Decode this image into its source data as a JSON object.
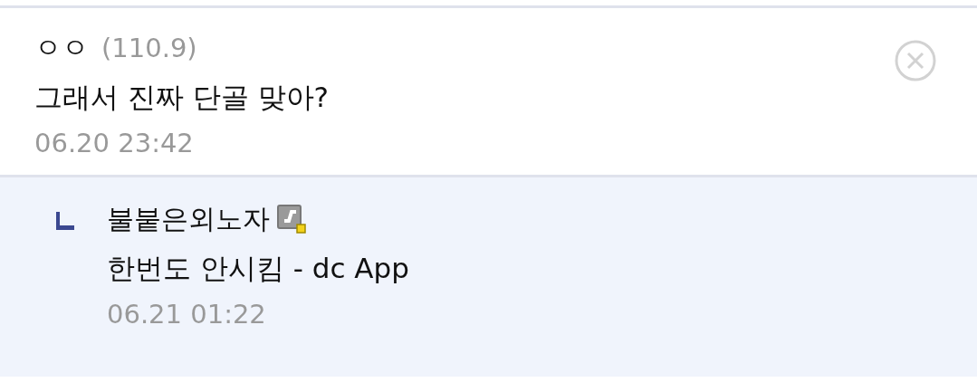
{
  "comment": {
    "nickname": "ㅇㅇ",
    "ip": "(110.9)",
    "text": "그래서 진짜 단골 맞아?",
    "date": "06.20 23:42"
  },
  "reply": {
    "nickname": "불붙은외노자",
    "text": "한번도 안시킴 - dc App",
    "date": "06.21 01:22"
  }
}
